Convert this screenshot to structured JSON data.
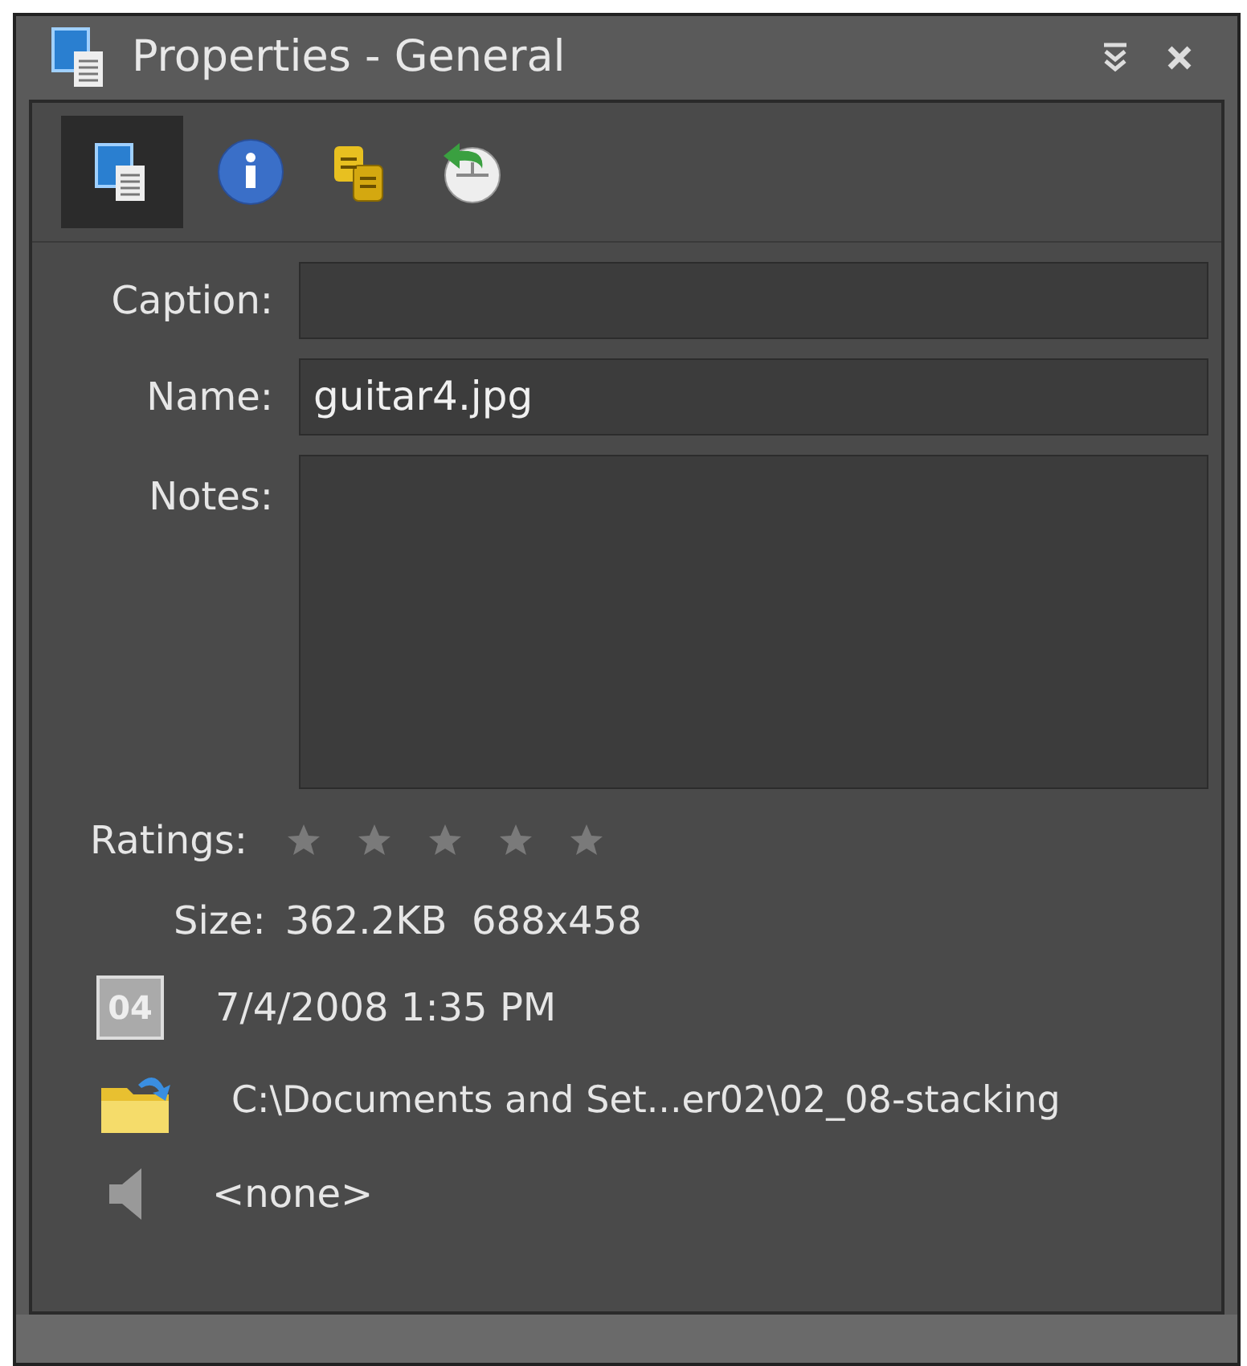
{
  "window": {
    "title": "Properties - General"
  },
  "toolbar": [
    {
      "kind": "general",
      "selected": true
    },
    {
      "kind": "info",
      "selected": false
    },
    {
      "kind": "keywords",
      "selected": false
    },
    {
      "kind": "history",
      "selected": false
    }
  ],
  "fields": [
    {
      "label": "Caption:"
    },
    {
      "label": "Name:",
      "value": "guitar4.jpg"
    }
  ],
  "notes": {
    "label": "Notes:"
  },
  "ratings": {
    "label": "Ratings:",
    "stars": 0
  },
  "size": {
    "label": "Size:",
    "value": "362.2KB  688x458"
  },
  "date": {
    "icon_text": "04",
    "value": "7/4/2008 1:35 PM"
  },
  "location": {
    "value": "C:\\Documents and Set...er02\\02_08-stacking"
  },
  "audio": {
    "value": "<none>"
  }
}
